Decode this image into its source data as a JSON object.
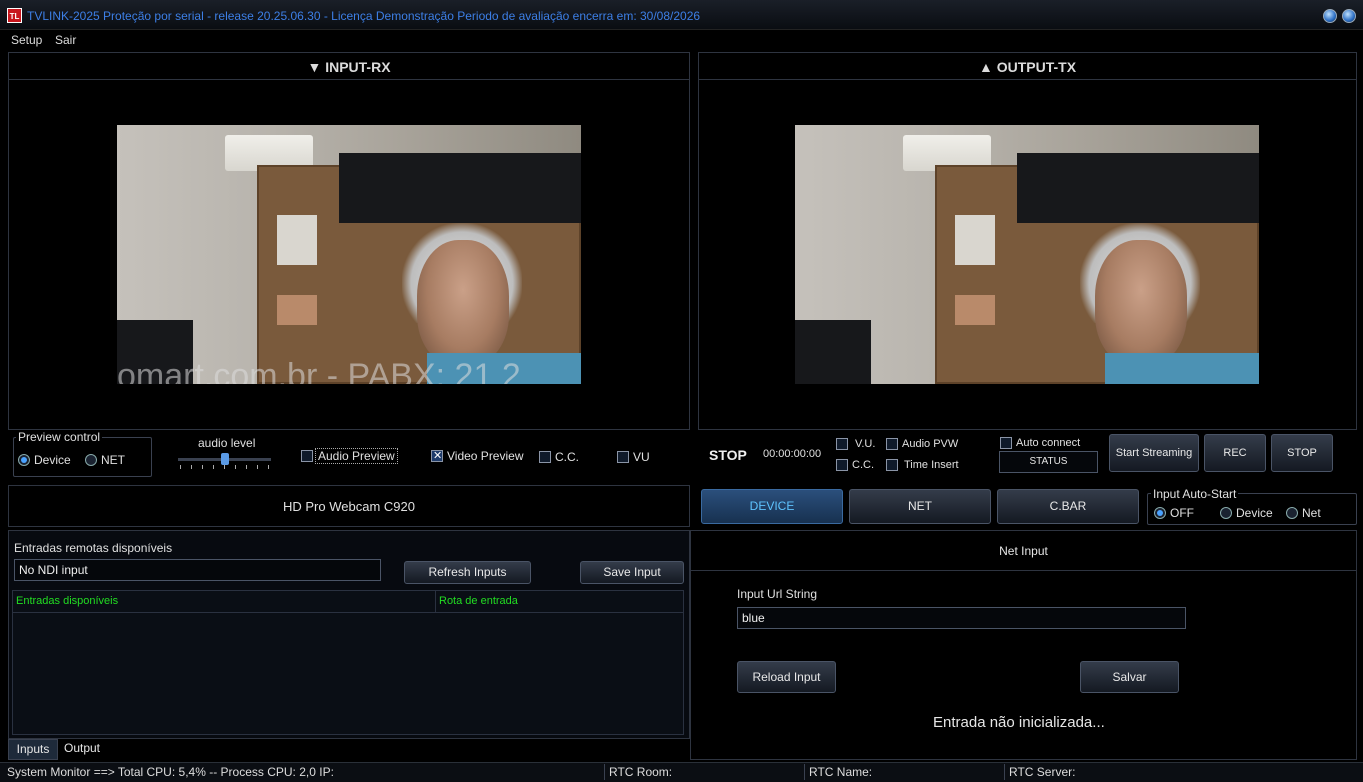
{
  "window": {
    "logo_text": "TL",
    "title": "TVLINK-2025  Proteção por serial     - release 20.25.06.30 - Licença  Demonstração  Periodo de avaliação encerra em: 30/08/2026"
  },
  "menu": [
    "Setup",
    "Sair"
  ],
  "input_panel": {
    "header": "▼ INPUT-RX",
    "watermark": "omart.com.br - PABX: 21 2",
    "preview_control": {
      "label": "Preview control",
      "options": [
        "Device",
        "NET"
      ],
      "selected": "Device"
    },
    "audio_level": {
      "label": "audio level",
      "value": 0.5
    },
    "audio_preview": {
      "label": "Audio Preview",
      "checked": false
    },
    "video_preview": {
      "label": "Video Preview",
      "checked": true
    },
    "cc": {
      "label": "C.C.",
      "checked": false
    },
    "vu": {
      "label": "VU",
      "checked": false
    },
    "device_name": "HD Pro Webcam C920"
  },
  "output_panel": {
    "header": "▲ OUTPUT-TX",
    "state": "STOP",
    "timer": "00:00:00:00",
    "vu": "V.U.",
    "audio_pvw": "Audio PVW",
    "cc": "C.C.",
    "time_insert": "Time Insert",
    "auto_connect": "Auto connect",
    "status_label": "STATUS",
    "start_streaming": "Start Streaming",
    "rec": "REC",
    "stop": "STOP"
  },
  "source_tabs": {
    "device": "DEVICE",
    "net": "NET",
    "cbar": "C.BAR",
    "selected": "DEVICE"
  },
  "auto_start": {
    "label": "Input Auto-Start",
    "options": [
      "OFF",
      "Device",
      "Net"
    ],
    "selected": "OFF"
  },
  "remote": {
    "label": "Entradas remotas disponíveis",
    "input_value": "No NDI input",
    "refresh": "Refresh  Inputs",
    "save": "Save Input",
    "columns": [
      "Entradas disponíveis",
      "Rota de entrada"
    ]
  },
  "bottom_tabs": {
    "inputs": "Inputs",
    "output": "Output",
    "selected": "Inputs"
  },
  "net_input": {
    "title": "Net Input",
    "url_label": "Input Url String",
    "url_value": "blue",
    "reload": "Reload Input",
    "save": "Salvar",
    "status": "Entrada não inicializada..."
  },
  "statusbar": {
    "system": "System Monitor ==> Total CPU: 5,4% -- Process CPU: 2,0 IP:",
    "rtc_room": "RTC Room:",
    "rtc_name": "RTC Name:",
    "rtc_server": "RTC Server:"
  },
  "colors": {
    "accent": "#3d7fe6",
    "green_header": "#22dd22",
    "selected_tab": "#5ec4ff"
  }
}
